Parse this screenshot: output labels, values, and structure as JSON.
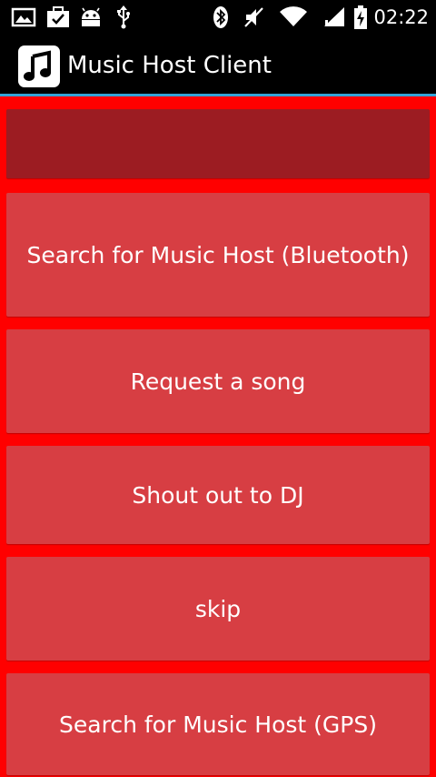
{
  "status_bar": {
    "time": "02:22",
    "icons": [
      "image-icon",
      "briefcase-check-icon",
      "android-icon",
      "usb-icon",
      "bluetooth-icon",
      "silent-icon",
      "wifi-icon",
      "signal-icon",
      "battery-charging-icon"
    ]
  },
  "action_bar": {
    "title": "Music Host Client",
    "icon": "music-note-icon",
    "accent_color": "#33a3d7"
  },
  "main": {
    "text_field_value": "",
    "buttons": [
      {
        "label": "Search for Music Host (Bluetooth)"
      },
      {
        "label": "Request a song"
      },
      {
        "label": "Shout out to DJ"
      },
      {
        "label": "skip"
      },
      {
        "label": "Search for Music Host (GPS)"
      }
    ]
  },
  "colors": {
    "background": "#ff0000",
    "button": "#d73e43",
    "field": "#9c1c22"
  }
}
